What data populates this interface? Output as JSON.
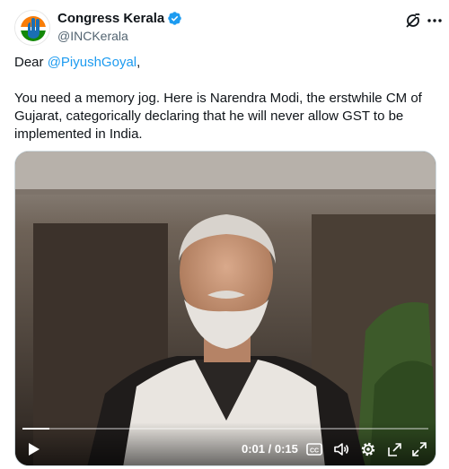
{
  "author": {
    "display_name": "Congress Kerala",
    "handle": "@INCKerala"
  },
  "tweet": {
    "greeting_prefix": "Dear ",
    "mention": "@PiyushGoyal",
    "greeting_suffix": ",",
    "body": "You need a memory jog. Here is Narendra Modi, the erstwhile CM of Gujarat, categorically declaring that he will never allow GST to be implemented in India."
  },
  "video": {
    "time_display": "0:01 / 0:15",
    "progress": 0.067,
    "cc_label": "CC"
  },
  "icons": {
    "verified": "verified-badge-icon",
    "grok": "grok-icon",
    "more": "more-icon",
    "play": "play-icon",
    "captions": "captions-icon",
    "volume": "volume-icon",
    "settings": "settings-icon",
    "pop_out": "pop-out-icon",
    "fullscreen": "fullscreen-icon"
  },
  "colors": {
    "accent": "#1d9bf0",
    "text": "#0f1419",
    "secondary_text": "#536471"
  }
}
